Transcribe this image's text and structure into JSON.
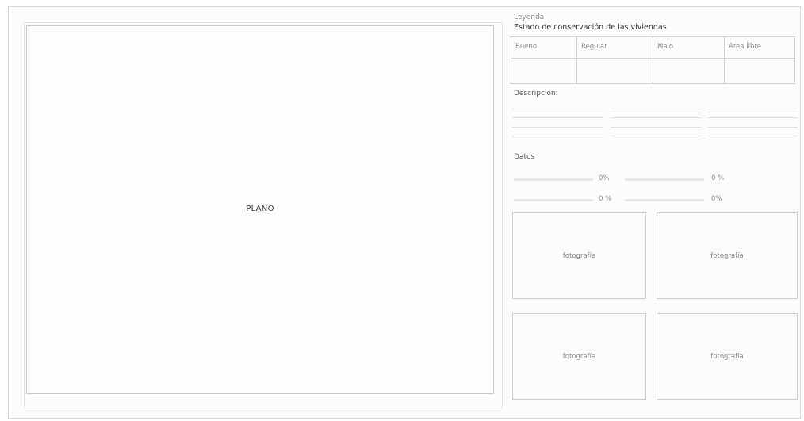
{
  "plan": {
    "label": "PLANO"
  },
  "legend": {
    "kicker": "Leyenda",
    "title": "Estado de conservación de las viviendas",
    "columns": [
      "Bueno",
      "Regular",
      "Malo",
      "Área libre"
    ]
  },
  "description": {
    "label": "Descripción:"
  },
  "stats": {
    "label": "Datos",
    "items": [
      {
        "value": "0%"
      },
      {
        "value": "0 %"
      },
      {
        "value": "0 %"
      },
      {
        "value": "0%"
      }
    ]
  },
  "photos": [
    "fotografía",
    "fotografía",
    "fotografía",
    "fotografía"
  ]
}
